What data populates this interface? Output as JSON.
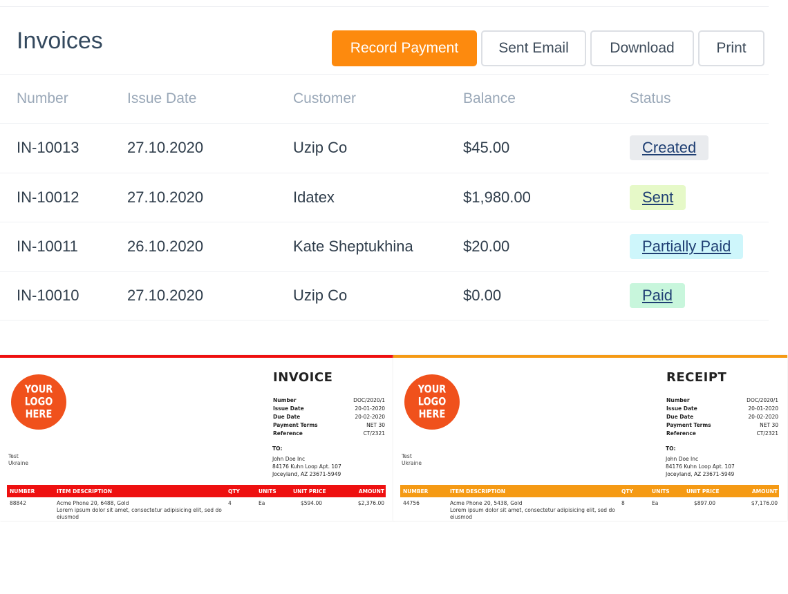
{
  "page": {
    "title": "Invoices"
  },
  "actions": {
    "record_payment": "Record Payment",
    "sent_email": "Sent Email",
    "download": "Download",
    "print": "Print"
  },
  "table": {
    "columns": [
      "Number",
      "Issue Date",
      "Customer",
      "Balance",
      "Status"
    ],
    "rows": [
      {
        "number": "IN-10013",
        "date": "27.10.2020",
        "customer": "Uzip Co",
        "balance": "$45.00",
        "status": "Created"
      },
      {
        "number": "IN-10012",
        "date": "27.10.2020",
        "customer": "Idatex",
        "balance": "$1,980.00",
        "status": "Sent"
      },
      {
        "number": "IN-10011",
        "date": "26.10.2020",
        "customer": "Kate Sheptukhina",
        "balance": "$20.00",
        "status": "Partially Paid"
      },
      {
        "number": "IN-10010",
        "date": "27.10.2020",
        "customer": "Uzip Co",
        "balance": "$0.00",
        "status": "Paid"
      }
    ]
  },
  "status_colors": {
    "Created": "#e9ebee",
    "Sent": "#e6f9c8",
    "Partially Paid": "#cef6fb",
    "Paid": "#c8f6dc"
  },
  "colors": {
    "accent": "#fd8a0e",
    "invoice_accent": "#ee1010",
    "receipt_accent": "#f59a14",
    "logo": "#f0511c"
  },
  "invoice_doc": {
    "logo": "YOUR LOGO HERE",
    "title": "INVOICE",
    "meta": [
      {
        "label": "Number",
        "value": "DOC/2020/1"
      },
      {
        "label": "Issue Date",
        "value": "20-01-2020"
      },
      {
        "label": "Due Date",
        "value": "20-02-2020"
      },
      {
        "label": "Payment Terms",
        "value": "NET 30"
      },
      {
        "label": "Reference",
        "value": "CT/2321"
      }
    ],
    "to_label": "TO:",
    "to_lines": [
      "John Doe Inc",
      "84176 Kuhn Loop Apt. 107",
      "Joceyland, AZ 23671-5949"
    ],
    "from_lines": [
      "Test",
      "Ukraine"
    ],
    "line_headers": {
      "number": "NUMBER",
      "desc": "ITEM DESCRIPTION",
      "qty": "QTY",
      "units": "UNITS",
      "price": "UNIT PRICE",
      "amount": "AMOUNT"
    },
    "line": {
      "number": "88842",
      "desc": "Acme Phone 20, 6488, Gold",
      "desc2": "Lorem ipsum dolor sit amet, consectetur adipisicing elit, sed do eiusmod",
      "qty": "4",
      "units": "Ea",
      "price": "$594.00",
      "amount": "$2,376.00"
    }
  },
  "receipt_doc": {
    "logo": "YOUR LOGO HERE",
    "title": "RECEIPT",
    "meta": [
      {
        "label": "Number",
        "value": "DOC/2020/1"
      },
      {
        "label": "Issue Date",
        "value": "20-01-2020"
      },
      {
        "label": "Due Date",
        "value": "20-02-2020"
      },
      {
        "label": "Payment Terms",
        "value": "NET 30"
      },
      {
        "label": "Reference",
        "value": "CT/2321"
      }
    ],
    "to_label": "TO:",
    "to_lines": [
      "John Doe Inc",
      "84176 Kuhn Loop Apt. 107",
      "Joceyland, AZ 23671-5949"
    ],
    "from_lines": [
      "Test",
      "Ukraine"
    ],
    "line_headers": {
      "number": "NUMBER",
      "desc": "ITEM DESCRIPTION",
      "qty": "QTY",
      "units": "UNITS",
      "price": "UNIT PRICE",
      "amount": "AMOUNT"
    },
    "line": {
      "number": "44756",
      "desc": "Acme Phone 20, 5438, Gold",
      "desc2": "Lorem ipsum dolor sit amet, consectetur adipisicing elit, sed do eiusmod",
      "qty": "8",
      "units": "Ea",
      "price": "$897.00",
      "amount": "$7,176.00"
    }
  }
}
